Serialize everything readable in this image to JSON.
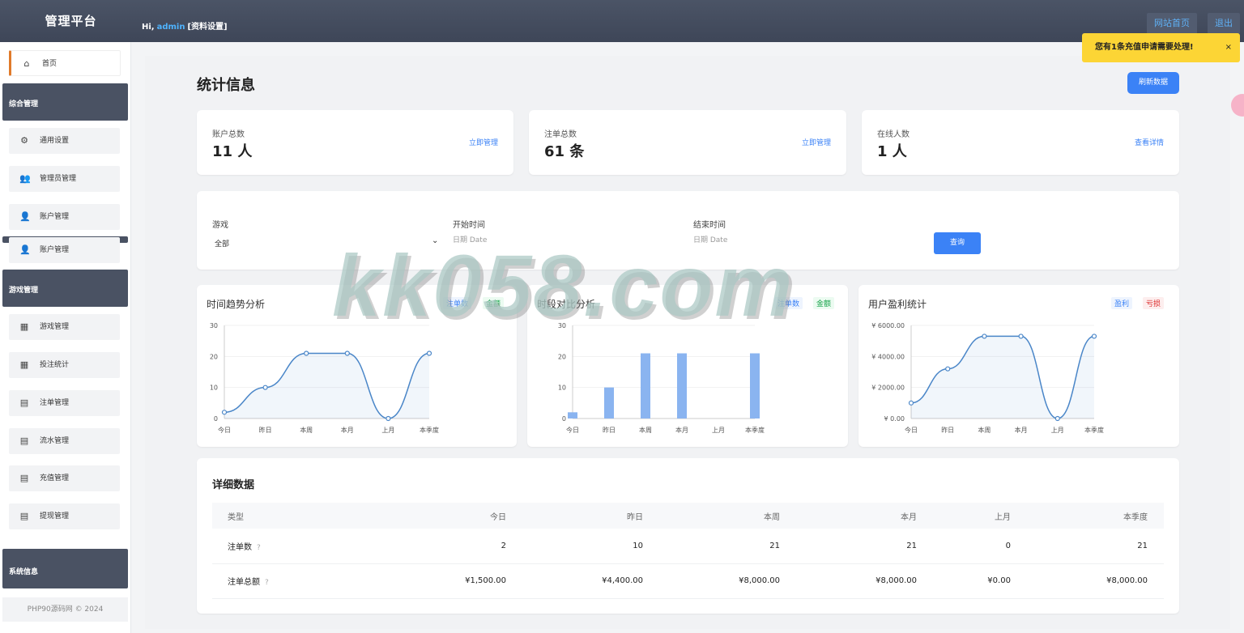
{
  "header": {
    "brand": "管理平台",
    "greet_prefix": "Hi,",
    "username": "admin",
    "profile_link": "[资料设置]",
    "home_button": "网站首页",
    "logout_button": "退出"
  },
  "sidebar": {
    "home": "首页",
    "group_general": "综合管理",
    "items_general": [
      "通用设置",
      "管理员管理",
      "账户管理",
      "账户管理"
    ],
    "group_game": "游戏管理",
    "items_game": [
      "游戏管理",
      "投注统计",
      "注单管理",
      "流水管理",
      "充值管理",
      "提现管理"
    ],
    "group_system": "系统信息",
    "footer": "PHP90源码网 © 2024"
  },
  "page": {
    "title": "统计信息",
    "refresh_button": "刷新数据"
  },
  "stats": [
    {
      "label": "账户总数",
      "value": "11 人",
      "link": "立即管理"
    },
    {
      "label": "注单总数",
      "value": "61 条",
      "link": "立即管理"
    },
    {
      "label": "在线人数",
      "value": "1 人",
      "link": "查看详情"
    }
  ],
  "filter": {
    "game_label": "游戏",
    "game_value": "全部",
    "start_label": "开始时间",
    "start_placeholder": "日期 Date",
    "end_label": "结束时间",
    "end_placeholder": "日期 Date",
    "query_button": "查询"
  },
  "charts": {
    "trend": {
      "title": "时间趋势分析",
      "legend": [
        "注单数",
        "金额"
      ]
    },
    "period": {
      "title": "时段对比分析",
      "legend": [
        "注单数",
        "金额"
      ]
    },
    "profit": {
      "title": "用户盈利统计",
      "legend": [
        "盈利",
        "亏损"
      ]
    }
  },
  "chart_data": [
    {
      "type": "line",
      "categories": [
        "今日",
        "昨日",
        "本周",
        "本月",
        "上月",
        "本季度"
      ],
      "series": [
        {
          "values": [
            2,
            10,
            21,
            21,
            0,
            21
          ]
        }
      ],
      "ylim": [
        0,
        30
      ],
      "yticks": [
        "0",
        "10",
        "20",
        "30"
      ]
    },
    {
      "type": "bar",
      "categories": [
        "今日",
        "昨日",
        "本周",
        "本月",
        "上月",
        "本季度"
      ],
      "series": [
        {
          "values": [
            2,
            10,
            21,
            21,
            0,
            21
          ]
        }
      ],
      "ylim": [
        0,
        30
      ],
      "yticks": [
        "0",
        "10",
        "20",
        "30"
      ]
    },
    {
      "type": "line",
      "categories": [
        "今日",
        "昨日",
        "本周",
        "本月",
        "上月",
        "本季度"
      ],
      "series": [
        {
          "values": [
            1000,
            3200,
            5300,
            5300,
            0,
            5300
          ]
        }
      ],
      "ylim": [
        0,
        6000
      ],
      "yticks": [
        "¥ 0.00",
        "¥ 2000.00",
        "¥ 4000.00",
        "¥ 6000.00"
      ]
    }
  ],
  "table": {
    "title": "详细数据",
    "headers": [
      "类型",
      "今日",
      "昨日",
      "本周",
      "本月",
      "上月",
      "本季度"
    ],
    "rows": [
      [
        "注单数",
        "2",
        "10",
        "21",
        "21",
        "0",
        "21"
      ],
      [
        "注单总额",
        "¥1,500.00",
        "¥4,400.00",
        "¥8,000.00",
        "¥8,000.00",
        "¥0.00",
        "¥8,000.00"
      ]
    ],
    "help": "?"
  },
  "toast": {
    "text": "您有1条充值申请需要处理!",
    "close": "×"
  },
  "watermark": "kk058.com",
  "colors": {
    "primary": "#3b82f6",
    "sidebar_group": "#4a5263",
    "toast": "#fcd535",
    "chart_line": "#4a86c8",
    "bar": "#8ab4f0"
  }
}
